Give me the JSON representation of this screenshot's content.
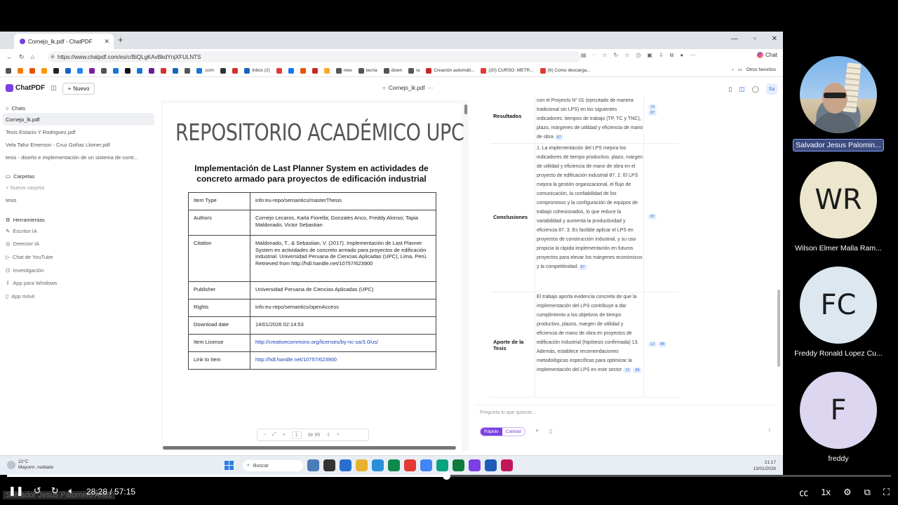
{
  "browser": {
    "tab_title": "Cornejo_lk.pdf - ChatPDF",
    "url": "https://www.chatpdf.com/es/c/BiQLgKAvBkdYnjXFULNTS",
    "chat_label": "Chat",
    "bookmarks": [
      {
        "label": "",
        "color": "#555"
      },
      {
        "label": "",
        "color": "#f57c00"
      },
      {
        "label": "",
        "color": "#e65100"
      },
      {
        "label": "",
        "color": "#ff9800"
      },
      {
        "label": "",
        "color": "#222"
      },
      {
        "label": "",
        "color": "#1565c0"
      },
      {
        "label": "",
        "color": "#1e88e5"
      },
      {
        "label": "",
        "color": "#7b1fa2"
      },
      {
        "label": "",
        "color": "#555"
      },
      {
        "label": "",
        "color": "#1976d2"
      },
      {
        "label": "",
        "color": "#111"
      },
      {
        "label": "",
        "color": "#1976d2"
      },
      {
        "label": "",
        "color": "#6a1b9a"
      },
      {
        "label": "",
        "color": "#d32f2f"
      },
      {
        "label": "",
        "color": "#1565c0"
      },
      {
        "label": "",
        "color": "#555"
      },
      {
        "label": ".com",
        "color": "#1976d2"
      },
      {
        "label": "",
        "color": "#333"
      },
      {
        "label": "",
        "color": "#d32f2f"
      },
      {
        "label": "Inbox (2)",
        "color": "#1565c0"
      },
      {
        "label": "",
        "color": "#e53935"
      },
      {
        "label": "",
        "color": "#1877f2"
      },
      {
        "label": "",
        "color": "#e65100"
      },
      {
        "label": "",
        "color": "#c62828"
      },
      {
        "label": "",
        "color": "#f9a825"
      },
      {
        "label": "new",
        "color": "#555"
      },
      {
        "label": "tecria",
        "color": "#555"
      },
      {
        "label": "down",
        "color": "#555"
      },
      {
        "label": "ia",
        "color": "#555"
      },
      {
        "label": "Creación automáti...",
        "color": "#c62828"
      },
      {
        "label": "(20) CURSO: METR...",
        "color": "#e53935"
      },
      {
        "label": "(6) Como descarga...",
        "color": "#e53935"
      }
    ],
    "other_favorites": "Otros favoritos"
  },
  "app": {
    "logo": "ChatPDF",
    "new_button": "Nuevo",
    "doc_title": "Cornejo_lk.pdf",
    "user_initials": "Sa"
  },
  "sidebar": {
    "chats_label": "Chats",
    "chats": [
      {
        "label": "Cornejo_lk.pdf",
        "active": true
      },
      {
        "label": "Tesis Estacio Y Rodriguez.pdf"
      },
      {
        "label": "Vela Tafur Emerson - Cruz Goñas Lloiner.pdf"
      },
      {
        "label": "tesis - diseño e implementación de un sistema de contr..."
      }
    ],
    "folders_label": "Carpetas",
    "new_folder": "Nueva carpeta",
    "folders": [
      "tesis"
    ],
    "tools_label": "Herramientas",
    "tools": [
      "Escritor IA",
      "Detector IA",
      "Chat de YouTube",
      "Investigación",
      "App para Windows",
      "App móvil"
    ]
  },
  "pdf": {
    "repo_title": "REPOSITORIO ACADÉMICO UPC",
    "heading": "Implementación de Last Planner System en actividades de concreto armado para proyectos de edificación industrial",
    "rows": [
      {
        "k": "Item Type",
        "v": "info:eu-repo/semantics/masterThesis"
      },
      {
        "k": "Authors",
        "v": "Cornejo Lecaros, Karla Fiorella; Gonzales Anco, Freddy Alonso; Tapia Maldonado, Victor Sebastian"
      },
      {
        "k": "Citation",
        "v": "Maldonado, T., & Sebastian, V. (2017). Implementación de Last Planner System en actividades de concreto armado para proyectos de edificación industrial. Universidad Peruana de Ciencias Aplicadas (UPC), Lima, Perú. Retrieved from http://hdl.handle.net/10757/623900"
      },
      {
        "k": "Publisher",
        "v": "Universidad Peruana de Ciencias Aplicadas (UPC)"
      },
      {
        "k": "Rights",
        "v": "info:eu-repo/semantics/openAccess"
      },
      {
        "k": "Download date",
        "v": "14/01/2026 02:14:53"
      },
      {
        "k": "Item License",
        "v": "http://creativecommons.org/licenses/by-nc-sa/3.0/us/",
        "link": true
      },
      {
        "k": "Link to Item",
        "v": "http://hdl.handle.net/10757/623900",
        "link": true
      }
    ],
    "toolbar": {
      "page": "1",
      "of": "de 96"
    }
  },
  "chat": {
    "rows": [
      {
        "k": "Resultados",
        "v": "con el Proyecto N° 01 (ejecutado de manera tradicional sin LPS) en los siguientes indicadores: tiempos de trabajo (TP, TC y TNC), plazo, márgenes de utilidad y eficiencia de mano de obra",
        "chips": [
          "87"
        ],
        "refs": [
          "79",
          "87"
        ]
      },
      {
        "k": "Conclusiones",
        "v": "1. La implementación del LPS mejora los indicadores de tiempo productivo, plazo, margen de utilidad y eficiencia de mano de obra en el proyecto de edificación industrial 87. 2. El LPS mejora la gestión organizacional, el flujo de comunicación, la confiabilidad de los compromisos y la configuración de equipos de trabajo cohesionados, lo que reduce la variabilidad y aumenta la productividad y eficiencia 87. 3. Es factible aplicar el LPS en proyectos de construcción industrial, y su uso propicia la rápida implementación en futuros proyectos para elevar los márgenes económicos y la competitividad",
        "chips": [
          "87"
        ],
        "refs": [
          "87"
        ]
      },
      {
        "k": "Aporte de la Tesis",
        "v": "El trabajo aporta evidencia concreta de que la implementación del LPS contribuye a dar cumplimiento a los objetivos de tiempo productivo, plazos, margen de utilidad y eficiencia de mano de obra en proyectos de edificación industrial (hipótesis confirmada) 13. Además, establece recomendaciones metodológicas específicas para optimizar la implementación del LPS en este sector",
        "chips": [
          "13",
          "88"
        ],
        "refs": [
          "13",
          "88"
        ]
      }
    ],
    "placeholder": "Pregunta lo que quieras...",
    "mode_fast": "Rápido",
    "mode_quality": "Calidad"
  },
  "taskbar": {
    "temp": "22°C",
    "weather": "Mayorm. nublado",
    "search": "Buscar",
    "time": "21:17",
    "date": "13/01/2026",
    "apps": [
      "#4a7db8",
      "#333",
      "#2a6fd0",
      "#e8b230",
      "#2a90d8",
      "#0f8a4d",
      "#e53935",
      "#4285f4",
      "#0aa37f",
      "#0f7b3d",
      "#7b3fe4",
      "#1e5bb8",
      "#c2185b"
    ]
  },
  "participants": [
    {
      "name": "Salvador Jesus Palomin...",
      "initials": "",
      "bg": "photo",
      "highlight": true
    },
    {
      "name": "Wilson Elmer Malla Ram...",
      "initials": "WR",
      "bg": "#ece6cf"
    },
    {
      "name": "Freddy Ronald Lopez Cu...",
      "initials": "FC",
      "bg": "#dce7ef"
    },
    {
      "name": "freddy",
      "initials": "F",
      "bg": "#ddd6f0"
    }
  ],
  "video": {
    "current": "28:28",
    "total": "57:15",
    "progress": 0.4972,
    "speed": "1x",
    "speaker_caption": "Salvador Jesus Palomino Ariez"
  }
}
